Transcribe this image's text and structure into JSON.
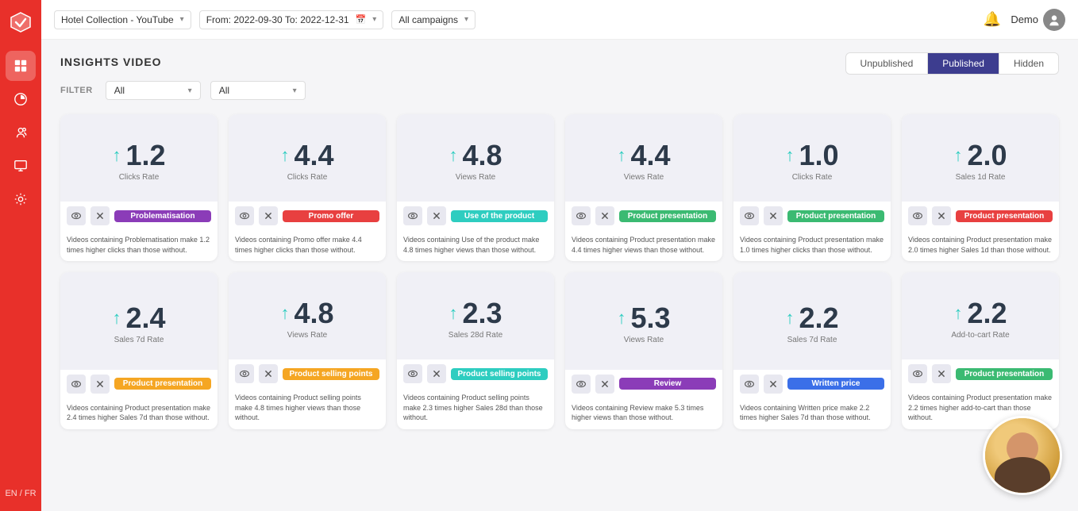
{
  "app": {
    "lang": "EN / FR"
  },
  "topbar": {
    "channel": "Hotel Collection - YouTube",
    "date_range": "From: 2022-09-30 To: 2022-12-31",
    "campaigns": "All campaigns",
    "bell_label": "notifications",
    "user": "Demo"
  },
  "page": {
    "title": "INSIGHTS VIDEO"
  },
  "tabs": {
    "unpublished": "Unpublished",
    "published": "Published",
    "hidden": "Hidden",
    "active": "published"
  },
  "filter": {
    "label": "FILTER",
    "filter1": "All",
    "filter2": "All"
  },
  "cards": [
    {
      "value": "1.2",
      "metric": "Clicks Rate",
      "tag": "Problematisation",
      "tag_color": "tag-purple",
      "description": "Videos containing Problematisation make 1.2 times higher clicks than those without."
    },
    {
      "value": "4.4",
      "metric": "Clicks Rate",
      "tag": "Promo offer",
      "tag_color": "tag-red",
      "description": "Videos containing Promo offer make 4.4 times higher clicks than those without."
    },
    {
      "value": "4.8",
      "metric": "Views Rate",
      "tag": "Use of the product",
      "tag_color": "tag-teal",
      "description": "Videos containing Use of the product make 4.8 times higher views than those without."
    },
    {
      "value": "4.4",
      "metric": "Views Rate",
      "tag": "Product presentation",
      "tag_color": "tag-green",
      "description": "Videos containing Product presentation make 4.4 times higher views than those without."
    },
    {
      "value": "1.0",
      "metric": "Clicks Rate",
      "tag": "Product presentation",
      "tag_color": "tag-green",
      "description": "Videos containing Product presentation make 1.0 times higher clicks than those without."
    },
    {
      "value": "2.0",
      "metric": "Sales 1d Rate",
      "tag": "Product presentation",
      "tag_color": "tag-red",
      "description": "Videos containing Product presentation make 2.0 times higher Sales 1d than those without."
    },
    {
      "value": "2.4",
      "metric": "Sales 7d Rate",
      "tag": "Product presentation",
      "tag_color": "tag-orange",
      "description": "Videos containing Product presentation make 2.4 times higher Sales 7d than those without."
    },
    {
      "value": "4.8",
      "metric": "Views Rate",
      "tag": "Product selling points",
      "tag_color": "tag-orange",
      "description": "Videos containing Product selling points make 4.8 times higher views than those without."
    },
    {
      "value": "2.3",
      "metric": "Sales 28d Rate",
      "tag": "Product selling points",
      "tag_color": "tag-teal",
      "description": "Videos containing Product selling points make 2.3 times higher Sales 28d than those without."
    },
    {
      "value": "5.3",
      "metric": "Views Rate",
      "tag": "Review",
      "tag_color": "tag-review",
      "description": "Videos containing Review make 5.3 times higher views than those without."
    },
    {
      "value": "2.2",
      "metric": "Sales 7d Rate",
      "tag": "Written price",
      "tag_color": "tag-written",
      "description": "Videos containing Written price make 2.2 times higher Sales 7d than those without."
    },
    {
      "value": "2.2",
      "metric": "Add-to-cart Rate",
      "tag": "Product presentation",
      "tag_color": "tag-green",
      "description": "Videos containing Product presentation make 2.2 times higher add-to-cart than those without."
    }
  ],
  "icons": {
    "eye": "👁",
    "x": "✕",
    "arrow_up": "↑",
    "arrow_down": "▾",
    "bell": "🔔",
    "chevron": "▾"
  }
}
